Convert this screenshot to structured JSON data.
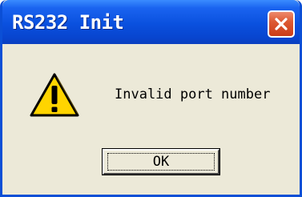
{
  "dialog": {
    "title": "RS232 Init",
    "message": "Invalid port number",
    "ok_label": "OK"
  },
  "icons": {
    "close": "close-icon",
    "warning": "warning-icon"
  },
  "colors": {
    "titlebar": "#0a50de",
    "body": "#ece9d8",
    "close_button": "#dd5a34",
    "warning_fill": "#ffd400"
  }
}
